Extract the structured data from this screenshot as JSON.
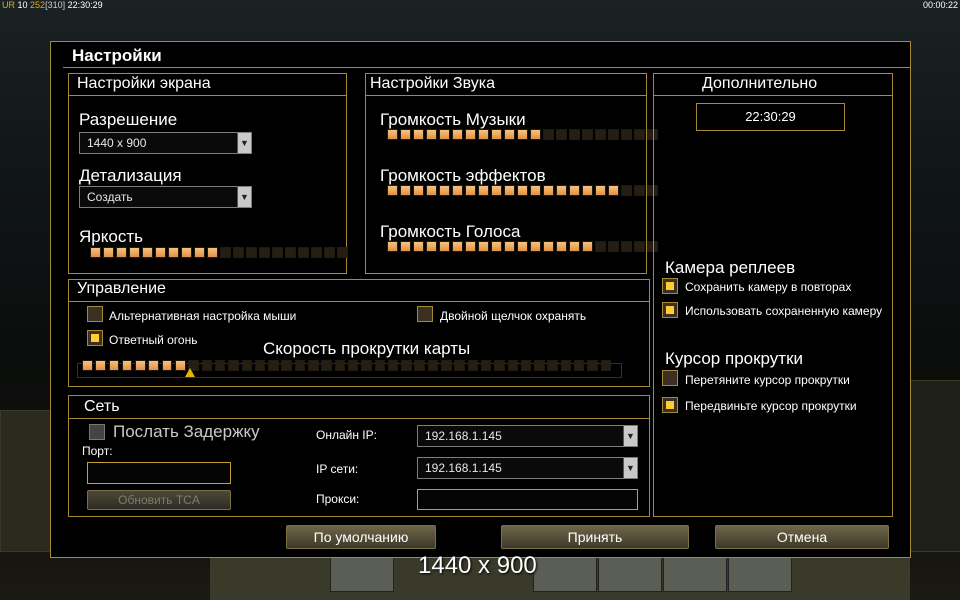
{
  "topbar": {
    "ur": "UR",
    "ur_num": "10",
    "money": "252",
    "power": "[310]",
    "time": "22:30:29",
    "timer": "00:00:22"
  },
  "dialog": {
    "title": "Настройки"
  },
  "screen": {
    "title": "Настройки экрана",
    "resolution_label": "Разрешение",
    "resolution_value": "1440 x 900",
    "detail_label": "Детализация",
    "detail_value": "Создать",
    "brightness_label": "Яркость",
    "brightness_level": 10,
    "brightness_max": 20
  },
  "sound": {
    "title": "Настройки Звука",
    "music_label": "Громкость Музыки",
    "music_level": 12,
    "effects_label": "Громкость эффектов",
    "effects_level": 18,
    "voice_label": "Громкость Голоса",
    "voice_level": 16,
    "max": 21
  },
  "extra": {
    "title": "Дополнительно",
    "clock": "22:30:29",
    "replay_camera_title": "Камера реплеев",
    "save_camera": "Сохранить камеру в повторах",
    "use_saved_camera": "Использовать сохраненную камеру",
    "scroll_cursor_title": "Курсор прокрутки",
    "drag_cursor": "Перетяните курсор прокрутки",
    "move_cursor": "Передвиньте курсор прокрутки"
  },
  "control": {
    "title": "Управление",
    "alt_mouse": "Альтернативная настройка мыши",
    "double_click": "Двойной щелчок охранять",
    "return_fire": "Ответный огонь",
    "scroll_speed_label": "Скорость прокрутки карты",
    "scroll_speed_level": 8,
    "scroll_speed_max": 40
  },
  "network": {
    "title": "Сеть",
    "send_delay": "Послать Задержку",
    "port_label": "Порт:",
    "port_value": "",
    "refresh_tca": "Обновить TCA",
    "online_ip_label": "Онлайн IP:",
    "online_ip_value": "192.168.1.145",
    "lan_ip_label": "IP сети:",
    "lan_ip_value": "192.168.1.145",
    "proxy_label": "Прокси:",
    "proxy_value": ""
  },
  "buttons": {
    "defaults": "По умолчанию",
    "accept": "Принять",
    "cancel": "Отмена"
  },
  "overlay": {
    "resolution": "1440 x 900"
  },
  "colors": {
    "accent": "#a48b33",
    "slider_on": "#f0a960",
    "check_on": "#ffcc33"
  }
}
